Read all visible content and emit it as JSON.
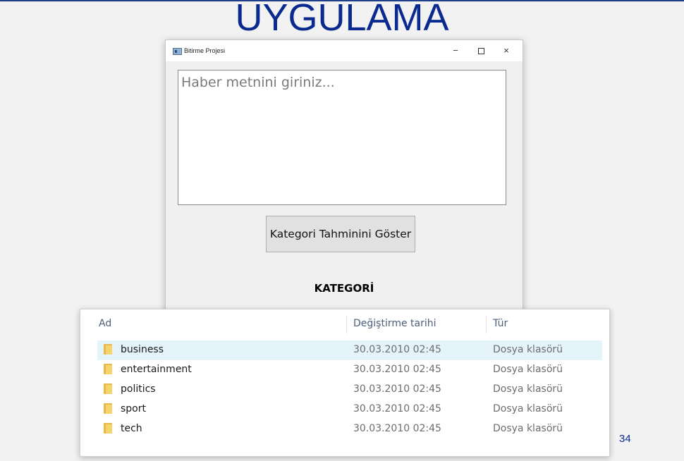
{
  "slide": {
    "title": "UYGULAMA",
    "page_number": "34"
  },
  "app": {
    "window_title": "Bitirme Projesi",
    "controls": {
      "minimize": "−",
      "close": "×"
    },
    "textarea_placeholder": "Haber metnini giriniz...",
    "predict_button_label": "Kategori Tahminini Göster",
    "category_label": "KATEGORİ"
  },
  "explorer": {
    "columns": {
      "name": "Ad",
      "modified": "Değiştirme tarihi",
      "type": "Tür"
    },
    "rows": [
      {
        "name": "business",
        "modified": "30.03.2010 02:45",
        "type": "Dosya klasörü",
        "icon": "folder-icon",
        "selected": true
      },
      {
        "name": "entertainment",
        "modified": "30.03.2010 02:45",
        "type": "Dosya klasörü",
        "icon": "folder-icon"
      },
      {
        "name": "politics",
        "modified": "30.03.2010 02:45",
        "type": "Dosya klasörü",
        "icon": "folder-icon"
      },
      {
        "name": "sport",
        "modified": "30.03.2010 02:45",
        "type": "Dosya klasörü",
        "icon": "folder-icon"
      },
      {
        "name": "tech",
        "modified": "30.03.2010 02:45",
        "type": "Dosya klasörü",
        "icon": "folder-icon"
      }
    ]
  },
  "colors": {
    "title_blue": "#0a2a8f",
    "selection": "#e5f3fb",
    "folder": "#f6d36b"
  }
}
